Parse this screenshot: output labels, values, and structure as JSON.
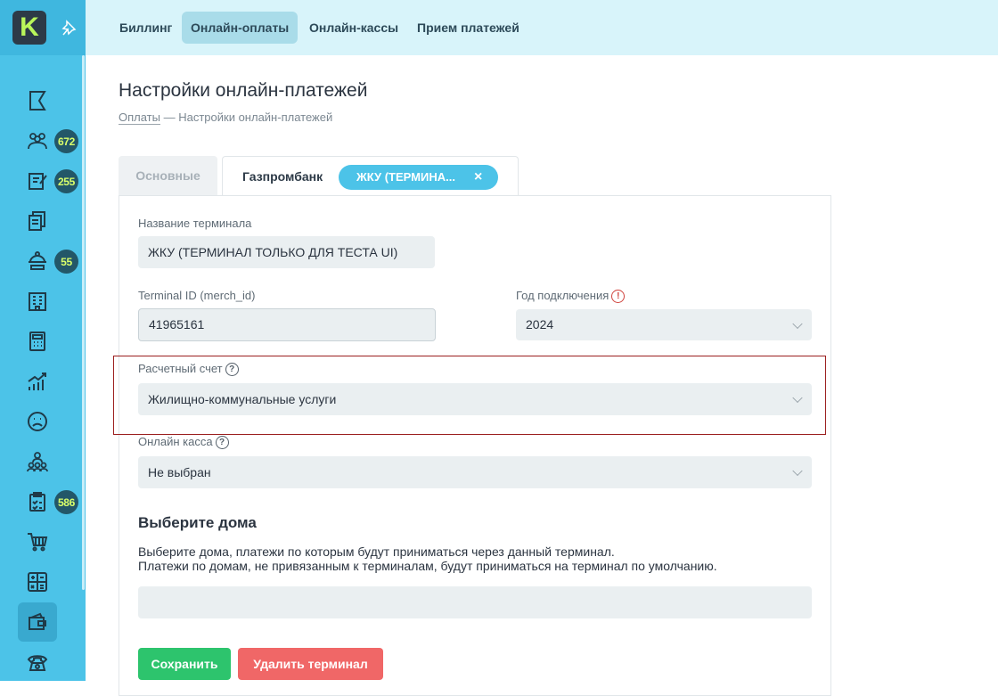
{
  "app": {
    "logo_letter": "K"
  },
  "sidebar": {
    "items": [
      {
        "icon": "flag-icon"
      },
      {
        "icon": "people-icon",
        "badge": "672"
      },
      {
        "icon": "note-edit-icon",
        "badge": "255"
      },
      {
        "icon": "documents-icon"
      },
      {
        "icon": "service-icon",
        "badge": "55"
      },
      {
        "icon": "building-icon"
      },
      {
        "icon": "calculator-icon"
      },
      {
        "icon": "growth-chart-icon"
      },
      {
        "icon": "sad-face-icon"
      },
      {
        "icon": "team-icon"
      },
      {
        "icon": "checklist-icon",
        "badge": "586"
      },
      {
        "icon": "cart-icon"
      },
      {
        "icon": "math-icon"
      },
      {
        "icon": "wallet-icon",
        "active": true
      },
      {
        "icon": "phone-icon"
      }
    ]
  },
  "topnav": {
    "items": [
      {
        "label": "Биллинг"
      },
      {
        "label": "Онлайн-оплаты",
        "active": true
      },
      {
        "label": "Онлайн-кассы"
      },
      {
        "label": "Прием платежей"
      }
    ]
  },
  "page": {
    "title": "Настройки онлайн-платежей",
    "breadcrumb_link": "Оплаты",
    "breadcrumb_sep": " — ",
    "breadcrumb_current": "Настройки онлайн-платежей"
  },
  "tabs": {
    "main": "Основные",
    "bank": "Газпромбанк",
    "terminal_chip": "ЖКУ (ТЕРМИНА...",
    "chip_close": "×"
  },
  "form": {
    "terminal_name_label": "Название терминала",
    "terminal_name_value": "ЖКУ (ТЕРМИНАЛ ТОЛЬКО ДЛЯ ТЕСТА UI)",
    "terminal_id_label": "Terminal ID (merch_id)",
    "terminal_id_value": "41965161",
    "year_label": "Год подключения",
    "year_value": "2024",
    "account_label": "Расчетный счет",
    "account_value": "Жилищно-коммунальные услуги",
    "cashbox_label": "Онлайн касса",
    "cashbox_value": "Не выбран",
    "houses_title": "Выберите дома",
    "houses_desc_1": "Выберите дома, платежи по которым будут приниматься через данный терминал.",
    "houses_desc_2": "Платежи по домам, не привязанным к терминалам, будут приниматься на терминал по умолчанию.",
    "houses_value": ""
  },
  "buttons": {
    "save": "Сохранить",
    "delete": "Удалить терминал"
  },
  "colors": {
    "sidebar": "#4cc3e8",
    "topbar": "#d8f4fa",
    "save": "#2dc46d",
    "delete": "#f06767",
    "chip": "#4cc3e8"
  }
}
